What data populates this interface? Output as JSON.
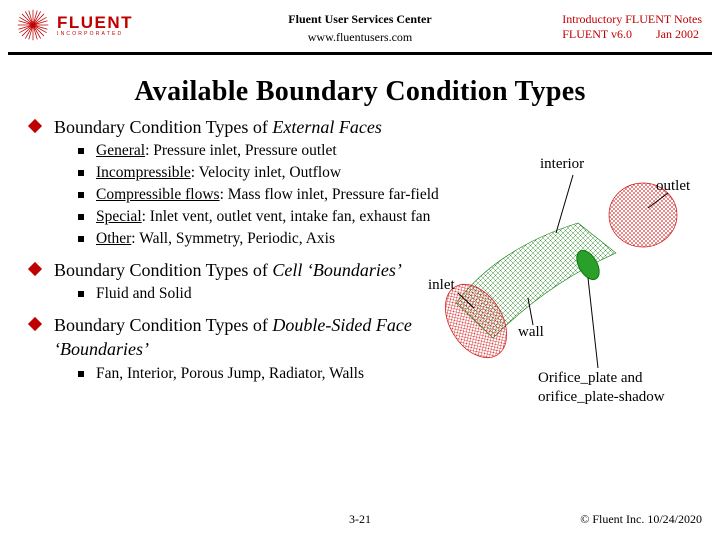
{
  "header": {
    "logo_main": "FLUENT",
    "logo_sub": "INCORPORATED",
    "center_title": "Fluent User Services Center",
    "center_url": "www.fluentusers.com",
    "right_line1": "Introductory FLUENT Notes",
    "right_line2a": "FLUENT v6.0",
    "right_line2b": "Jan 2002"
  },
  "title": "Available Boundary Condition Types",
  "sections": [
    {
      "heading_prefix": "Boundary Condition Types of ",
      "heading_italic": "External Faces",
      "heading_suffix": "",
      "items": [
        {
          "label": "General",
          "text": ":  Pressure inlet, Pressure outlet"
        },
        {
          "label": "Incompressible",
          "text": ":  Velocity inlet, Outflow"
        },
        {
          "label": "Compressible flows",
          "text": ":  Mass flow inlet, Pressure far-field"
        },
        {
          "label": "Special",
          "text": ":  Inlet vent, outlet vent, intake fan, exhaust fan"
        },
        {
          "label": "Other",
          "text": ":  Wall, Symmetry, Periodic, Axis"
        }
      ]
    },
    {
      "heading_prefix": "Boundary Condition Types of ",
      "heading_italic": "Cell ‘Boundaries’",
      "heading_suffix": "",
      "items": [
        {
          "label": "",
          "text": "Fluid and Solid"
        }
      ]
    },
    {
      "heading_prefix": "Boundary Condition Types of ",
      "heading_italic": "Double-Sided Face ‘Boundaries’",
      "heading_suffix": "",
      "items": [
        {
          "label": "",
          "text": "Fan, Interior, Porous Jump, Radiator, Walls"
        }
      ]
    }
  ],
  "figure": {
    "labels": {
      "interior": "interior",
      "outlet": "outlet",
      "inlet": "inlet",
      "wall": "wall",
      "orifice": "Orifice_plate and orifice_plate-shadow"
    }
  },
  "footer": {
    "page": "3-21",
    "copyright": "© Fluent Inc. 10/24/2020"
  },
  "colors": {
    "accent": "#c00000"
  }
}
